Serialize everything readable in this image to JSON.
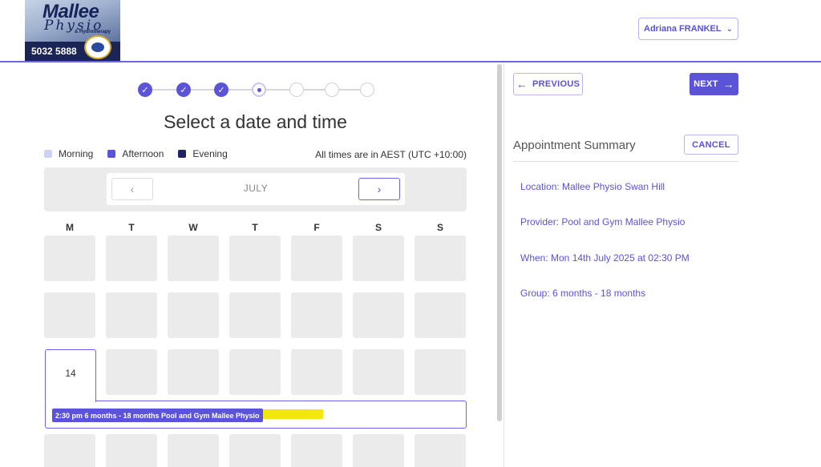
{
  "header": {
    "logo": {
      "brand": "Mallee",
      "sub": "Physio",
      "tagline": "& Hydrotherapy",
      "phone": "5032 5888"
    },
    "user_name": "Adriana FRANKEL"
  },
  "stepper": {
    "completed": 3,
    "current": 4,
    "total": 7
  },
  "title": "Select a date and time",
  "legend": [
    {
      "label": "Morning",
      "color": "#cdd2f5"
    },
    {
      "label": "Afternoon",
      "color": "#5b53d8"
    },
    {
      "label": "Evening",
      "color": "#1f2366"
    }
  ],
  "timezone_note": "All times are in AEST (UTC +10:00)",
  "calendar": {
    "month": "JULY",
    "weekdays": [
      "M",
      "T",
      "W",
      "T",
      "F",
      "S",
      "S"
    ],
    "selected_day": "14",
    "slot_text": "2:30 pm 6 months - 18 months Pool and Gym Mallee Physio"
  },
  "nav": {
    "previous": "PREVIOUS",
    "next": "NEXT"
  },
  "summary": {
    "title": "Appointment Summary",
    "cancel": "CANCEL",
    "location": "Location: Mallee Physio Swan Hill",
    "provider": "Provider: Pool and Gym Mallee Physio",
    "when": "When: Mon 14th July 2025 at 02:30 PM",
    "group": "Group: 6 months - 18 months"
  },
  "colors": {
    "accent": "#5b53d8",
    "highlight": "#f2e600"
  },
  "icons": {
    "prev": "arrow-left-icon",
    "next": "arrow-right-icon",
    "user_menu": "chevron-down-icon",
    "month_prev": "chevron-left-icon",
    "month_next": "chevron-right-icon",
    "step_done": "check-icon"
  }
}
